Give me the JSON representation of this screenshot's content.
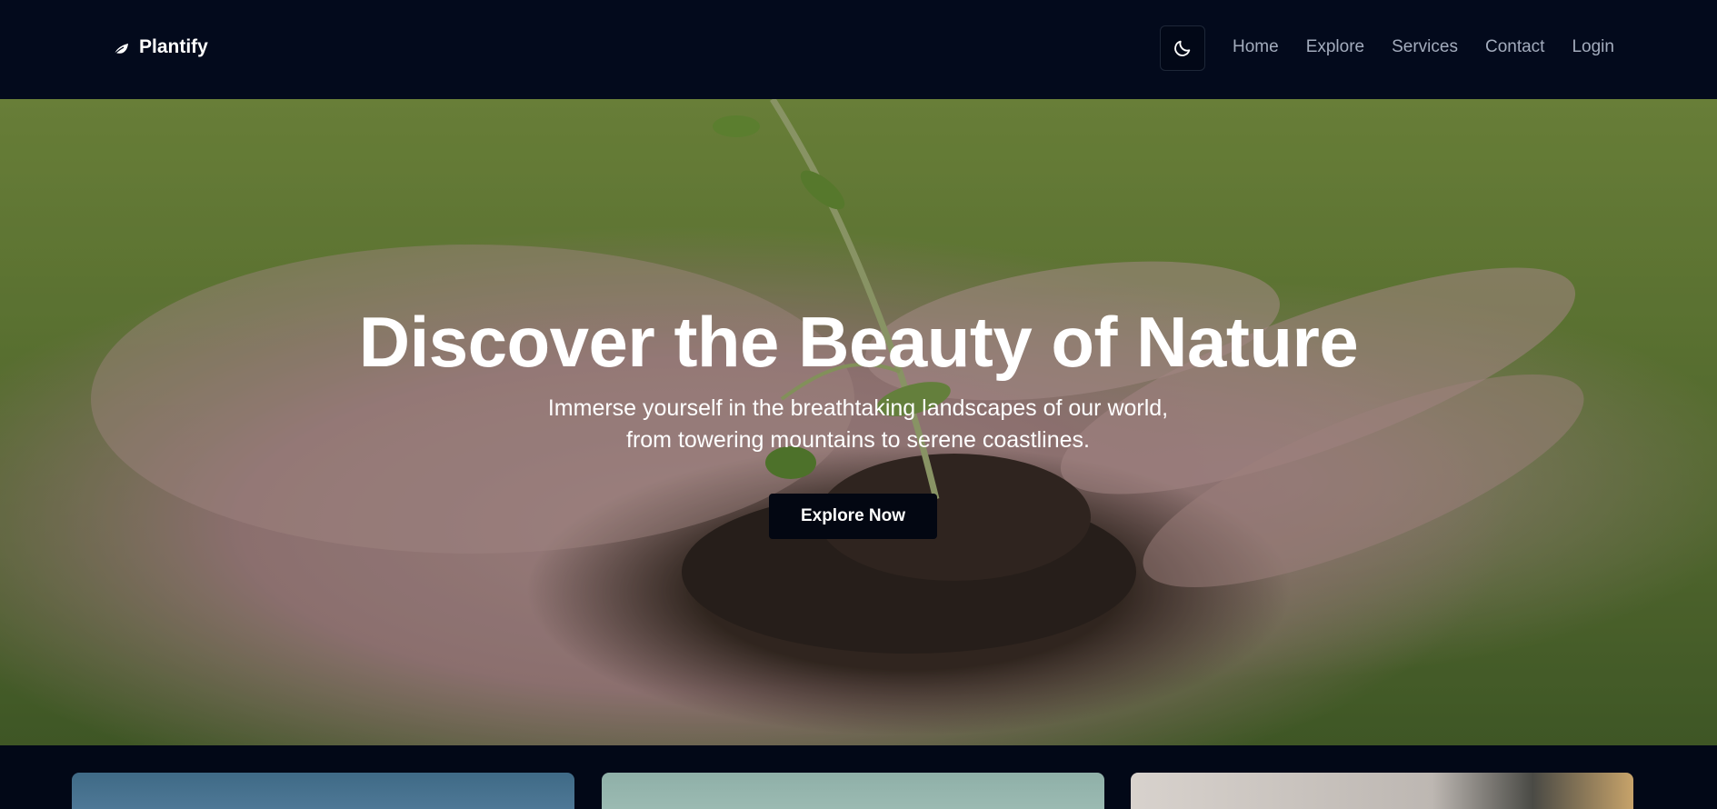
{
  "brand": {
    "name": "Plantify",
    "icon": "leaf-icon"
  },
  "nav": {
    "theme_toggle_icon": "moon-icon",
    "links": [
      "Home",
      "Explore",
      "Services",
      "Contact",
      "Login"
    ]
  },
  "hero": {
    "title": "Discover the Beauty of Nature",
    "subtitle_line1": "Immerse yourself in the breathtaking landscapes of our world,",
    "subtitle_line2": "from towering mountains to serene coastlines.",
    "button_label": "Explore Now"
  },
  "colors": {
    "navbar_bg": "#030a1c",
    "page_bg": "#020817",
    "button_bg": "#030712",
    "link_color": "#a3acbd"
  }
}
